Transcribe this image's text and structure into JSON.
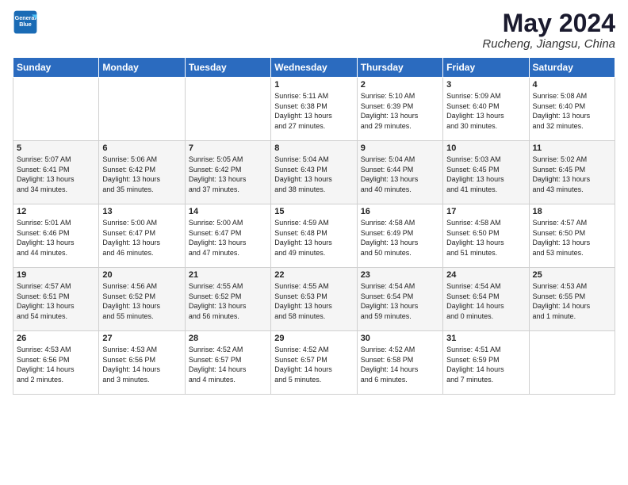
{
  "header": {
    "logo_line1": "General",
    "logo_line2": "Blue",
    "month": "May 2024",
    "location": "Rucheng, Jiangsu, China"
  },
  "weekdays": [
    "Sunday",
    "Monday",
    "Tuesday",
    "Wednesday",
    "Thursday",
    "Friday",
    "Saturday"
  ],
  "weeks": [
    [
      {
        "day": "",
        "info": ""
      },
      {
        "day": "",
        "info": ""
      },
      {
        "day": "",
        "info": ""
      },
      {
        "day": "1",
        "info": "Sunrise: 5:11 AM\nSunset: 6:38 PM\nDaylight: 13 hours\nand 27 minutes."
      },
      {
        "day": "2",
        "info": "Sunrise: 5:10 AM\nSunset: 6:39 PM\nDaylight: 13 hours\nand 29 minutes."
      },
      {
        "day": "3",
        "info": "Sunrise: 5:09 AM\nSunset: 6:40 PM\nDaylight: 13 hours\nand 30 minutes."
      },
      {
        "day": "4",
        "info": "Sunrise: 5:08 AM\nSunset: 6:40 PM\nDaylight: 13 hours\nand 32 minutes."
      }
    ],
    [
      {
        "day": "5",
        "info": "Sunrise: 5:07 AM\nSunset: 6:41 PM\nDaylight: 13 hours\nand 34 minutes."
      },
      {
        "day": "6",
        "info": "Sunrise: 5:06 AM\nSunset: 6:42 PM\nDaylight: 13 hours\nand 35 minutes."
      },
      {
        "day": "7",
        "info": "Sunrise: 5:05 AM\nSunset: 6:42 PM\nDaylight: 13 hours\nand 37 minutes."
      },
      {
        "day": "8",
        "info": "Sunrise: 5:04 AM\nSunset: 6:43 PM\nDaylight: 13 hours\nand 38 minutes."
      },
      {
        "day": "9",
        "info": "Sunrise: 5:04 AM\nSunset: 6:44 PM\nDaylight: 13 hours\nand 40 minutes."
      },
      {
        "day": "10",
        "info": "Sunrise: 5:03 AM\nSunset: 6:45 PM\nDaylight: 13 hours\nand 41 minutes."
      },
      {
        "day": "11",
        "info": "Sunrise: 5:02 AM\nSunset: 6:45 PM\nDaylight: 13 hours\nand 43 minutes."
      }
    ],
    [
      {
        "day": "12",
        "info": "Sunrise: 5:01 AM\nSunset: 6:46 PM\nDaylight: 13 hours\nand 44 minutes."
      },
      {
        "day": "13",
        "info": "Sunrise: 5:00 AM\nSunset: 6:47 PM\nDaylight: 13 hours\nand 46 minutes."
      },
      {
        "day": "14",
        "info": "Sunrise: 5:00 AM\nSunset: 6:47 PM\nDaylight: 13 hours\nand 47 minutes."
      },
      {
        "day": "15",
        "info": "Sunrise: 4:59 AM\nSunset: 6:48 PM\nDaylight: 13 hours\nand 49 minutes."
      },
      {
        "day": "16",
        "info": "Sunrise: 4:58 AM\nSunset: 6:49 PM\nDaylight: 13 hours\nand 50 minutes."
      },
      {
        "day": "17",
        "info": "Sunrise: 4:58 AM\nSunset: 6:50 PM\nDaylight: 13 hours\nand 51 minutes."
      },
      {
        "day": "18",
        "info": "Sunrise: 4:57 AM\nSunset: 6:50 PM\nDaylight: 13 hours\nand 53 minutes."
      }
    ],
    [
      {
        "day": "19",
        "info": "Sunrise: 4:57 AM\nSunset: 6:51 PM\nDaylight: 13 hours\nand 54 minutes."
      },
      {
        "day": "20",
        "info": "Sunrise: 4:56 AM\nSunset: 6:52 PM\nDaylight: 13 hours\nand 55 minutes."
      },
      {
        "day": "21",
        "info": "Sunrise: 4:55 AM\nSunset: 6:52 PM\nDaylight: 13 hours\nand 56 minutes."
      },
      {
        "day": "22",
        "info": "Sunrise: 4:55 AM\nSunset: 6:53 PM\nDaylight: 13 hours\nand 58 minutes."
      },
      {
        "day": "23",
        "info": "Sunrise: 4:54 AM\nSunset: 6:54 PM\nDaylight: 13 hours\nand 59 minutes."
      },
      {
        "day": "24",
        "info": "Sunrise: 4:54 AM\nSunset: 6:54 PM\nDaylight: 14 hours\nand 0 minutes."
      },
      {
        "day": "25",
        "info": "Sunrise: 4:53 AM\nSunset: 6:55 PM\nDaylight: 14 hours\nand 1 minute."
      }
    ],
    [
      {
        "day": "26",
        "info": "Sunrise: 4:53 AM\nSunset: 6:56 PM\nDaylight: 14 hours\nand 2 minutes."
      },
      {
        "day": "27",
        "info": "Sunrise: 4:53 AM\nSunset: 6:56 PM\nDaylight: 14 hours\nand 3 minutes."
      },
      {
        "day": "28",
        "info": "Sunrise: 4:52 AM\nSunset: 6:57 PM\nDaylight: 14 hours\nand 4 minutes."
      },
      {
        "day": "29",
        "info": "Sunrise: 4:52 AM\nSunset: 6:57 PM\nDaylight: 14 hours\nand 5 minutes."
      },
      {
        "day": "30",
        "info": "Sunrise: 4:52 AM\nSunset: 6:58 PM\nDaylight: 14 hours\nand 6 minutes."
      },
      {
        "day": "31",
        "info": "Sunrise: 4:51 AM\nSunset: 6:59 PM\nDaylight: 14 hours\nand 7 minutes."
      },
      {
        "day": "",
        "info": ""
      }
    ]
  ]
}
